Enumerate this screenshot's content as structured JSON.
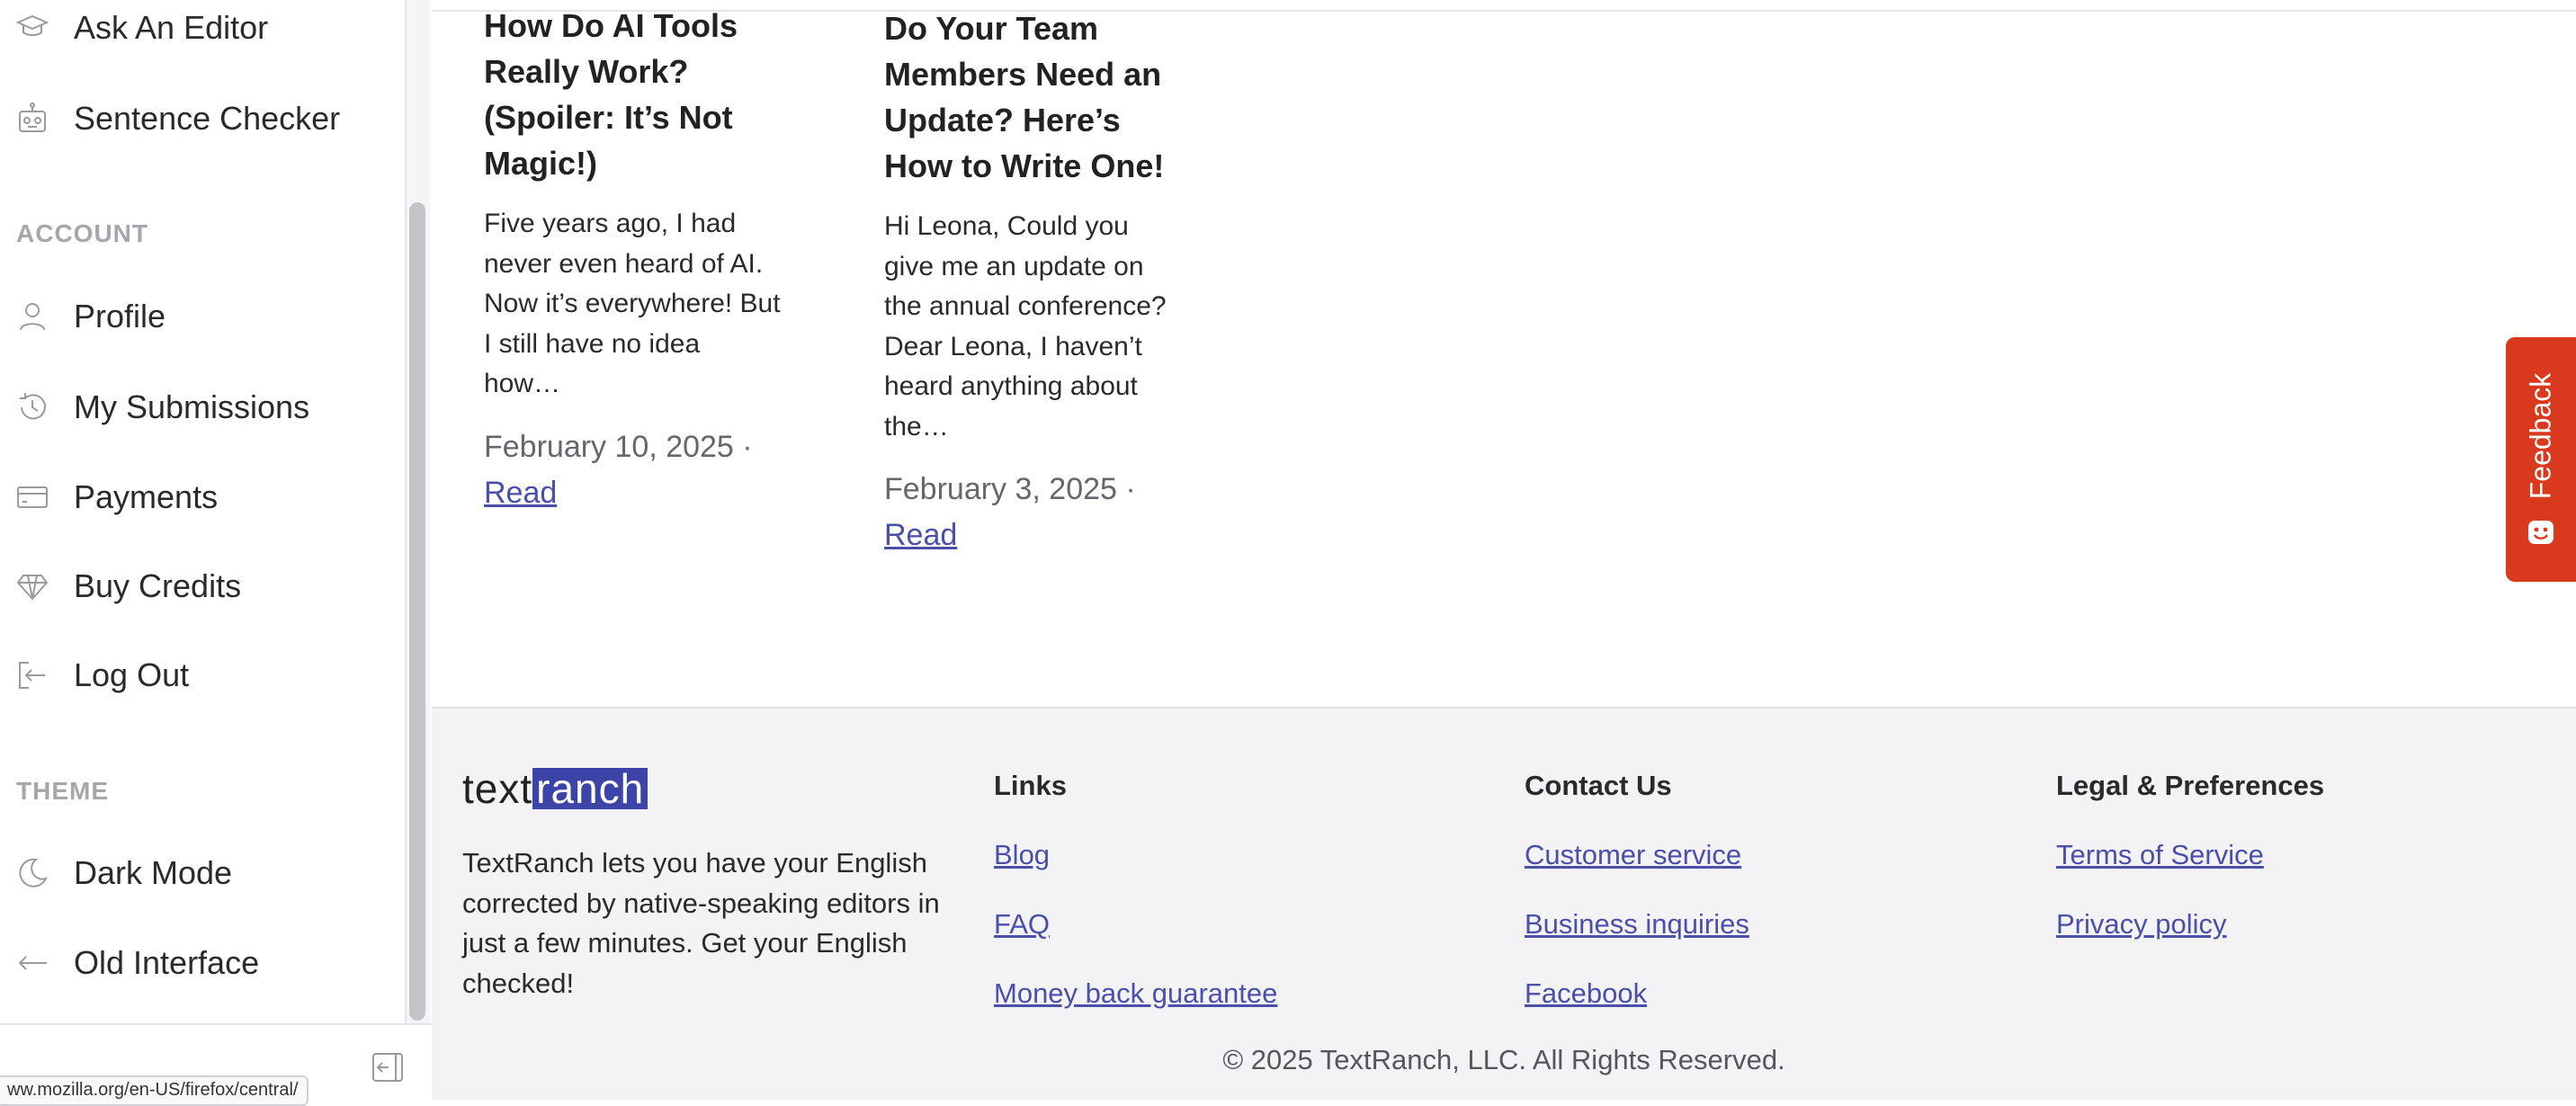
{
  "sidebar": {
    "top_items": [
      {
        "label": "Ask An Editor",
        "icon": "graduation-cap-icon"
      },
      {
        "label": "Sentence Checker",
        "icon": "robot-icon"
      }
    ],
    "account_heading": "ACCOUNT",
    "account_items": [
      {
        "label": "Profile",
        "icon": "user-icon"
      },
      {
        "label": "My Submissions",
        "icon": "history-icon"
      },
      {
        "label": "Payments",
        "icon": "credit-card-icon"
      },
      {
        "label": "Buy Credits",
        "icon": "diamond-icon"
      },
      {
        "label": "Log Out",
        "icon": "logout-icon"
      }
    ],
    "theme_heading": "THEME",
    "theme_items": [
      {
        "label": "Dark Mode",
        "icon": "moon-icon"
      },
      {
        "label": "Old Interface",
        "icon": "arrow-left-icon"
      }
    ],
    "status_url": "ww.mozilla.org/en-US/firefox/central/"
  },
  "posts": [
    {
      "title": "How Do AI Tools Really Work? (Spoiler: It’s Not Magic!)",
      "excerpt": "Five years ago, I had never even heard of AI. Now it’s everywhere! But I still have no idea how…",
      "date": "February 10, 2025 ·",
      "read_label": "Read"
    },
    {
      "title": "Do Your Team Members Need an Update? Here’s How to Write One!",
      "excerpt": "Hi Leona, Could you give me an update on the annual conference? Dear Leona, I haven’t heard anything about the…",
      "date": "February 3, 2025 ·",
      "read_label": "Read"
    }
  ],
  "feedback_label": "Feedback",
  "footer": {
    "logo_part1": "text",
    "logo_part2": "ranch",
    "about": "TextRanch lets you have your English corrected by native-speaking editors in just a few minutes. Get your English checked!",
    "links_heading": "Links",
    "links": [
      "Blog",
      "FAQ",
      "Money back guarantee"
    ],
    "contact_heading": "Contact Us",
    "contact": [
      "Customer service",
      "Business inquiries",
      "Facebook"
    ],
    "legal_heading": "Legal & Preferences",
    "legal": [
      "Terms of Service",
      "Privacy policy"
    ],
    "copyright": "© 2025 TextRanch, LLC. All Rights Reserved."
  },
  "colors": {
    "accent": "#3d44a8",
    "link": "#4a4fa8",
    "feedback": "#d9391c",
    "footer_bg": "#f3f3f6"
  }
}
